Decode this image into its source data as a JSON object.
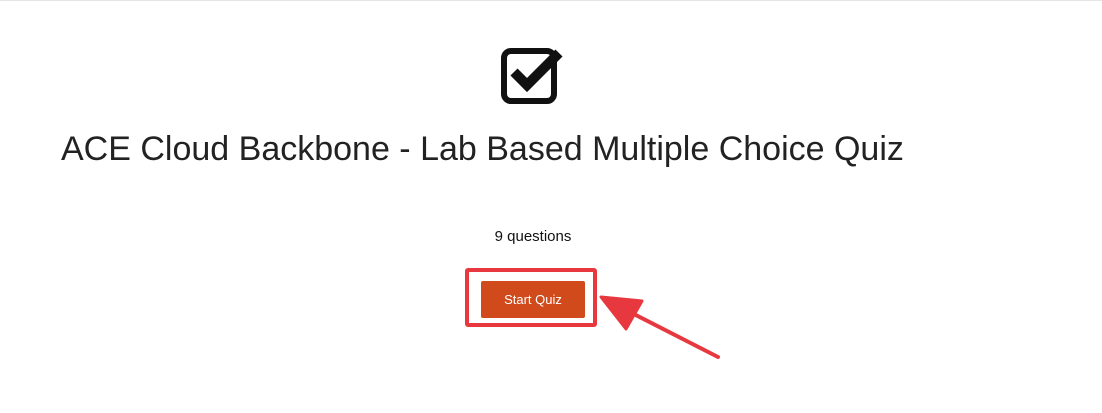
{
  "quiz": {
    "icon": "check-square-icon",
    "title": "ACE Cloud Backbone - Lab Based Multiple Choice Quiz",
    "question_count": "9 questions",
    "start_label": "Start Quiz"
  },
  "annotation": {
    "highlight_color": "#e8383f",
    "arrow_color": "#e8383f"
  },
  "colors": {
    "button_bg": "#d04a1b",
    "button_text": "#ffffff",
    "title_text": "#222222"
  }
}
